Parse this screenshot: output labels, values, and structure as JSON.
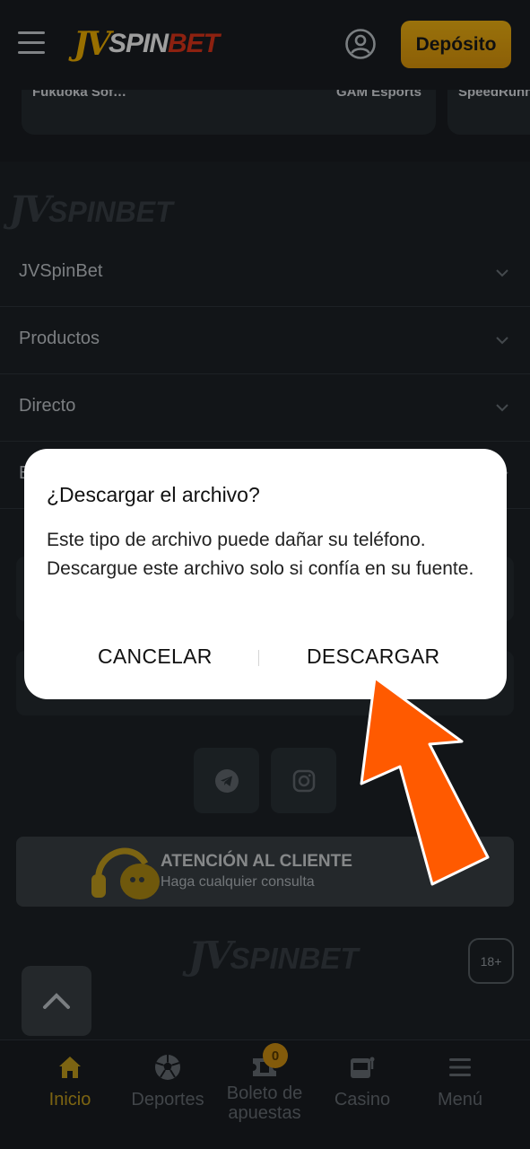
{
  "header": {
    "logo": {
      "jv": "JV",
      "spin": "SPIN",
      "bet": "BET"
    },
    "deposit_label": "Depósito"
  },
  "events": [
    "Fukuoka Sof…",
    "GAM Esports",
    "SpeedRunn"
  ],
  "footer": {
    "logo": {
      "jv": "JV",
      "spin": "SPINBET"
    },
    "accordion": [
      {
        "label": "JVSpinBet"
      },
      {
        "label": "Productos"
      },
      {
        "label": "Directo"
      },
      {
        "label": "E"
      }
    ],
    "social": [
      "telegram-icon",
      "instagram-icon"
    ],
    "support": {
      "title": "ATENCIÓN AL CLIENTE",
      "subtitle": "Haga cualquier consulta"
    },
    "age_badge": "18+"
  },
  "bottom_nav": {
    "items": [
      {
        "label": "Inicio",
        "icon": "home-icon",
        "active": true
      },
      {
        "label": "Deportes",
        "icon": "soccer-ball-icon",
        "active": false
      },
      {
        "label": "Boleto de apuestas",
        "icon": "ticket-icon",
        "active": false
      },
      {
        "label": "Casino",
        "icon": "slot-machine-icon",
        "active": false
      },
      {
        "label": "Menú",
        "icon": "menu-icon",
        "active": false
      }
    ],
    "bet_slip_count": "0"
  },
  "dialog": {
    "title": "¿Descargar el archivo?",
    "message": "Este tipo de archivo puede dañar su teléfono. Descargue este archivo solo si confía en su fuente.",
    "cancel_label": "CANCELAR",
    "download_label": "DESCARGAR"
  },
  "colors": {
    "accent": "#f5b400",
    "arrow": "#ff5a00",
    "background": "#1e2328"
  }
}
